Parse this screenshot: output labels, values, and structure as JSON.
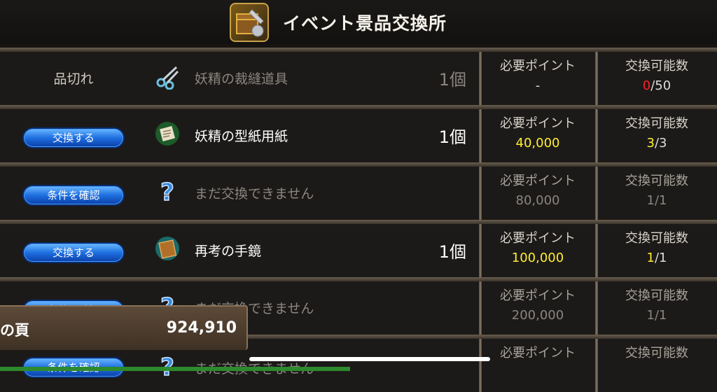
{
  "header": {
    "title": "イベント景品交換所",
    "icon": "treasure-chest-icon"
  },
  "columns": {
    "points_label": "必要ポイント",
    "exchange_label": "交換可能数"
  },
  "rows": [
    {
      "status": "品切れ",
      "icon": "scissors-icon",
      "name": "妖精の裁縫道具",
      "qty": "1個",
      "points": "-",
      "count_current": "0",
      "count_rest": "/50"
    },
    {
      "button": "交換する",
      "icon": "paper-icon",
      "name": "妖精の型紙用紙",
      "qty": "1個",
      "points": "40,000",
      "count_current": "3",
      "count_rest": "/3"
    },
    {
      "button": "条件を確認",
      "icon": "question-mark-icon",
      "name": "まだ交換できません",
      "qty": "",
      "points": "80,000",
      "count_current": "1",
      "count_rest": "/1"
    },
    {
      "button": "交換する",
      "icon": "book-icon",
      "name": "再考の手鏡",
      "qty": "1個",
      "points": "100,000",
      "count_current": "1",
      "count_rest": "/1"
    },
    {
      "button": "条件を確認",
      "icon": "question-mark-icon",
      "name": "まだ交換できません",
      "qty": "",
      "points": "200,000",
      "count_current": "1",
      "count_rest": "/1"
    },
    {
      "button": "条件を確認",
      "icon": "question-mark-icon",
      "name": "まだ交換できません",
      "qty": "",
      "points": "",
      "count_current": "",
      "count_rest": ""
    }
  ],
  "overlay": {
    "label": "の頁",
    "value": "924,910"
  },
  "colors": {
    "accent_yellow": "#ffee33",
    "soldout_red": "#ff2020",
    "button_blue": "#1e6fe0"
  }
}
